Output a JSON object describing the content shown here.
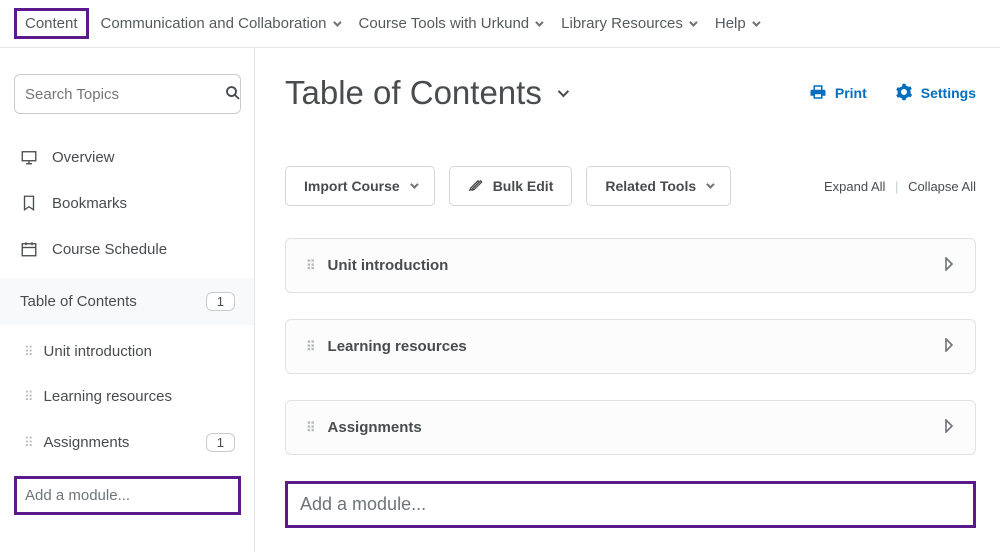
{
  "topnav": {
    "items": [
      {
        "label": "Content",
        "dropdown": false,
        "highlighted": true
      },
      {
        "label": "Communication and Collaboration",
        "dropdown": true
      },
      {
        "label": "Course Tools with Urkund",
        "dropdown": true
      },
      {
        "label": "Library Resources",
        "dropdown": true
      },
      {
        "label": "Help",
        "dropdown": true
      }
    ]
  },
  "sidebar": {
    "search_placeholder": "Search Topics",
    "nav": [
      {
        "label": "Overview",
        "icon": "overview-icon"
      },
      {
        "label": "Bookmarks",
        "icon": "bookmark-icon"
      },
      {
        "label": "Course Schedule",
        "icon": "calendar-icon"
      }
    ],
    "toc_label": "Table of Contents",
    "toc_count": "1",
    "modules": [
      {
        "label": "Unit introduction",
        "count": ""
      },
      {
        "label": "Learning resources",
        "count": ""
      },
      {
        "label": "Assignments",
        "count": "1"
      }
    ],
    "add_module_placeholder": "Add a module..."
  },
  "main": {
    "title": "Table of Contents",
    "print_label": "Print",
    "settings_label": "Settings",
    "toolbar": {
      "import_label": "Import Course",
      "bulk_edit_label": "Bulk Edit",
      "related_tools_label": "Related Tools",
      "expand_label": "Expand All",
      "collapse_label": "Collapse All"
    },
    "modules": [
      {
        "label": "Unit introduction"
      },
      {
        "label": "Learning resources"
      },
      {
        "label": "Assignments"
      }
    ],
    "add_module_placeholder": "Add a module..."
  }
}
